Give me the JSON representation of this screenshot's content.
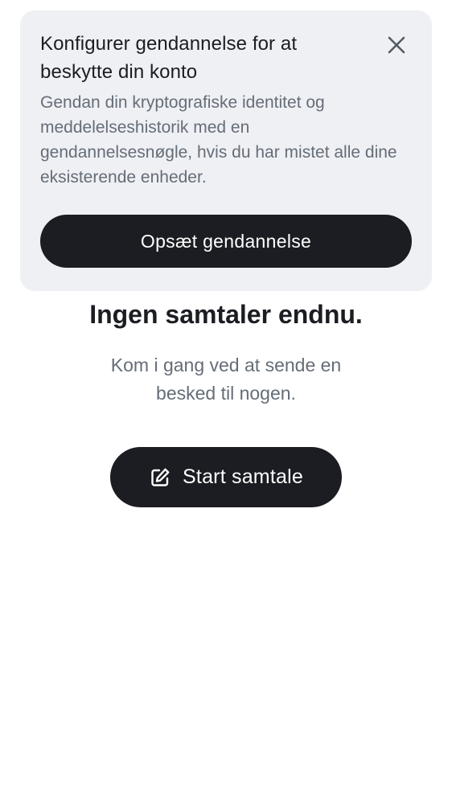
{
  "banner": {
    "title": "Konfigurer gendannelse for at beskytte din konto",
    "description": "Gendan din kryptografiske identitet og meddelelseshistorik med en gendannelsesnøgle, hvis du har mistet alle dine eksisterende enheder.",
    "close_icon": "close-icon",
    "button_label": "Opsæt gendannelse"
  },
  "empty_state": {
    "title": "Ingen samtaler endnu.",
    "description": "Kom i gang ved at sende en besked til nogen.",
    "button_label": "Start samtale",
    "button_icon": "compose-icon"
  },
  "colors": {
    "banner_background": "#eff0f4",
    "button_background": "#1b1d22",
    "button_text": "#ffffff",
    "muted_text": "#656d77",
    "heading_text": "#1b1d22"
  }
}
